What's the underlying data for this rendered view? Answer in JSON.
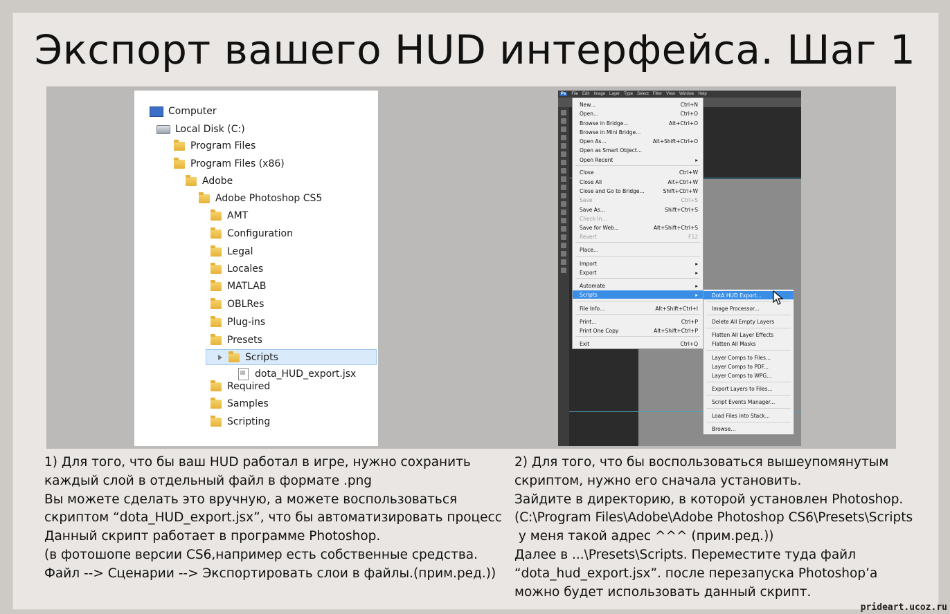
{
  "title": "Экспорт вашего HUD интерфейса. Шаг 1",
  "explorer": {
    "computer": "Computer",
    "local_disk": "Local Disk (C:)",
    "program_files": "Program Files",
    "program_files_x86": "Program Files (x86)",
    "adobe": "Adobe",
    "photoshop": "Adobe Photoshop CS5",
    "amt": "AMT",
    "configuration": "Configuration",
    "legal": "Legal",
    "locales": "Locales",
    "matlab": "MATLAB",
    "oblres": "OBLRes",
    "plugins": "Plug-ins",
    "presets": "Presets",
    "scripts": "Scripts",
    "script_file": "dota_HUD_export.jsx",
    "required": "Required",
    "samples": "Samples",
    "scripting": "Scripting"
  },
  "photoshop": {
    "logo": "Ps",
    "menubar": [
      "File",
      "Edit",
      "Image",
      "Layer",
      "Type",
      "Select",
      "Filter",
      "View",
      "Window",
      "Help"
    ],
    "file_menu": [
      {
        "label": "New...",
        "shortcut": "Ctrl+N"
      },
      {
        "label": "Open...",
        "shortcut": "Ctrl+O"
      },
      {
        "label": "Browse in Bridge...",
        "shortcut": "Alt+Ctrl+O"
      },
      {
        "label": "Browse in Mini Bridge...",
        "shortcut": ""
      },
      {
        "label": "Open As...",
        "shortcut": "Alt+Shift+Ctrl+O"
      },
      {
        "label": "Open as Smart Object...",
        "shortcut": ""
      },
      {
        "label": "Open Recent",
        "shortcut": "▸"
      },
      {
        "label": "Close",
        "shortcut": "Ctrl+W"
      },
      {
        "label": "Close All",
        "shortcut": "Alt+Ctrl+W"
      },
      {
        "label": "Close and Go to Bridge...",
        "shortcut": "Shift+Ctrl+W"
      },
      {
        "label": "Save",
        "shortcut": "Ctrl+S"
      },
      {
        "label": "Save As...",
        "shortcut": "Shift+Ctrl+S"
      },
      {
        "label": "Check In...",
        "shortcut": ""
      },
      {
        "label": "Save for Web...",
        "shortcut": "Alt+Shift+Ctrl+S"
      },
      {
        "label": "Revert",
        "shortcut": "F12"
      },
      {
        "label": "Place...",
        "shortcut": ""
      },
      {
        "label": "Import",
        "shortcut": "▸"
      },
      {
        "label": "Export",
        "shortcut": "▸"
      },
      {
        "label": "Automate",
        "shortcut": "▸"
      },
      {
        "label": "Scripts",
        "shortcut": "▸"
      },
      {
        "label": "File Info...",
        "shortcut": "Alt+Shift+Ctrl+I"
      },
      {
        "label": "Print...",
        "shortcut": "Ctrl+P"
      },
      {
        "label": "Print One Copy",
        "shortcut": "Alt+Shift+Ctrl+P"
      },
      {
        "label": "Exit",
        "shortcut": "Ctrl+Q"
      }
    ],
    "scripts_submenu": [
      "DotA HUD Export...",
      "Image Processor...",
      "Delete All Empty Layers",
      "Flatten All Layer Effects",
      "Flatten All Masks",
      "Layer Comps to Files...",
      "Layer Comps to PDF...",
      "Layer Comps to WPG...",
      "Export Layers to Files...",
      "Script Events Manager...",
      "Load Files into Stack...",
      "Browse..."
    ]
  },
  "left_text": "1) Для того, что бы ваш HUD работал в игре, нужно сохранить\nкаждый слой в отдельный файл в формате .png\nВы можете сделать это вручную, а можете воспользоваться\nскриптом “dota_HUD_export.jsx”, что бы автоматизировать процесс\nДанный скрипт работает в программе Photoshop.\n(в фотошопе версии CS6,например есть собственные средства.\nФайл --> Сценарии --> Экспортировать слои в файлы.(прим.ред.))",
  "right_text": "2) Для того, что бы воспользоваться вышеупомянутым\nскриптом, нужно его сначала установить.\nЗайдите в директорию, в которой установлен Photoshop.\n(C:\\Program Files\\Adobe\\Adobe Photoshop CS6\\Presets\\Scripts\n у меня такой адрес ^^^ (прим.ред.))\nДалее в ...\\Presets\\Scripts. Переместите туда файл\n“dota_hud_export.jsx”. после перезапуска Photoshop’a\nможно будет использовать данный скрипт.",
  "watermark": "prideart.ucoz.ru"
}
